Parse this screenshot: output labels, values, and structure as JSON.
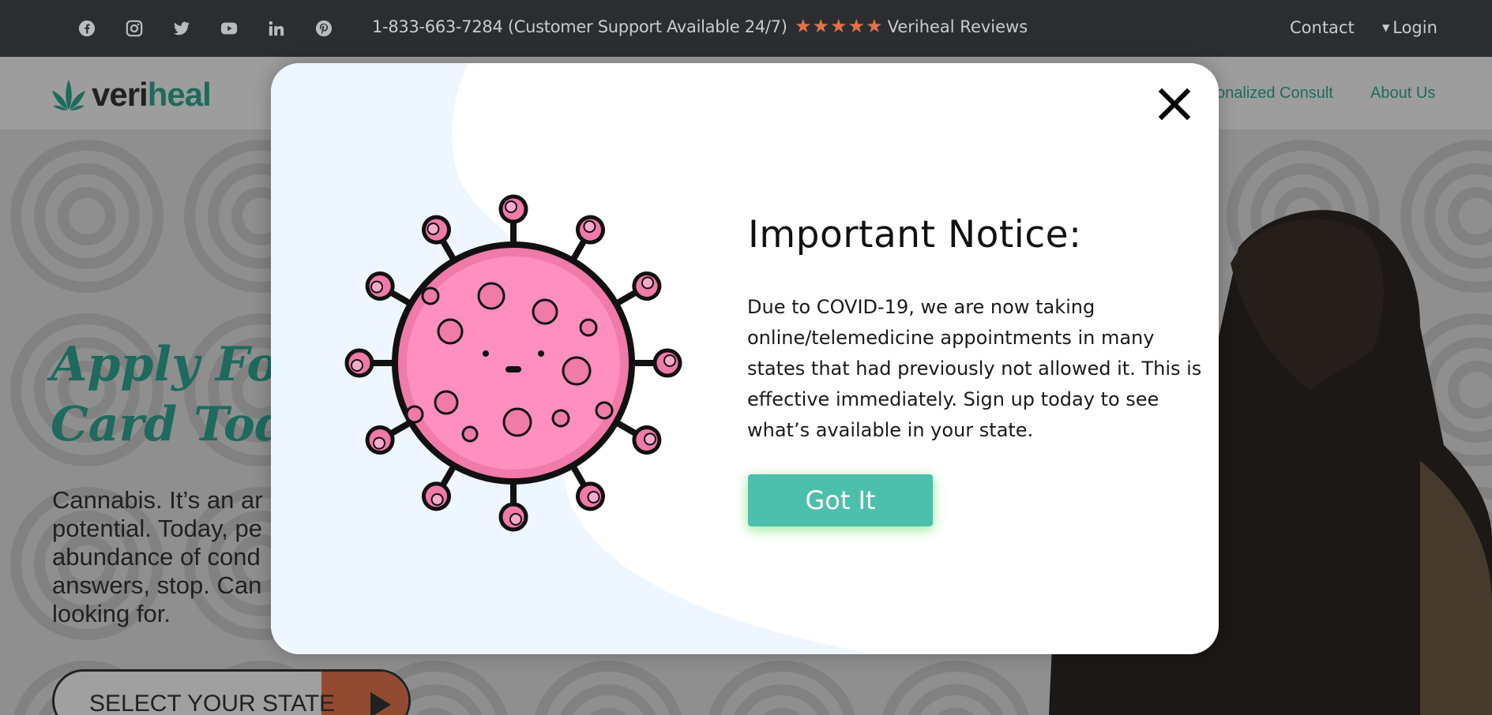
{
  "topbar": {
    "social_icons": [
      "facebook-icon",
      "instagram-icon",
      "twitter-icon",
      "youtube-icon",
      "linkedin-icon",
      "pinterest-icon"
    ],
    "phone": "1-833-663-7284 (Customer Support Available 24/7)",
    "reviews_label": "Veriheal Reviews",
    "rating_stars": 5,
    "contact": "Contact",
    "login": "Login"
  },
  "header": {
    "logo_veri": "veri",
    "logo_heal": "heal",
    "nav": [
      "onalized Consult",
      "About Us"
    ]
  },
  "hero": {
    "title": "Apply For Y\nCard Today",
    "copy": "Cannabis. It’s an ar\npotential. Today, pe\nabundance of cond\nanswers, stop. Can\nlooking for.",
    "select_state": "SELECT YOUR STATE"
  },
  "modal": {
    "title": "Important Notice:",
    "body": "Due to COVID-19, we are now taking online/telemedicine appointments in many states that had previously not allowed it. This is effective immediately. Sign up today to see what’s available in your state.",
    "button": "Got It"
  },
  "colors": {
    "accent": "#2fa38e",
    "button": "#4dbfad",
    "star": "#e0734a",
    "topbar": "#2b2e30"
  }
}
